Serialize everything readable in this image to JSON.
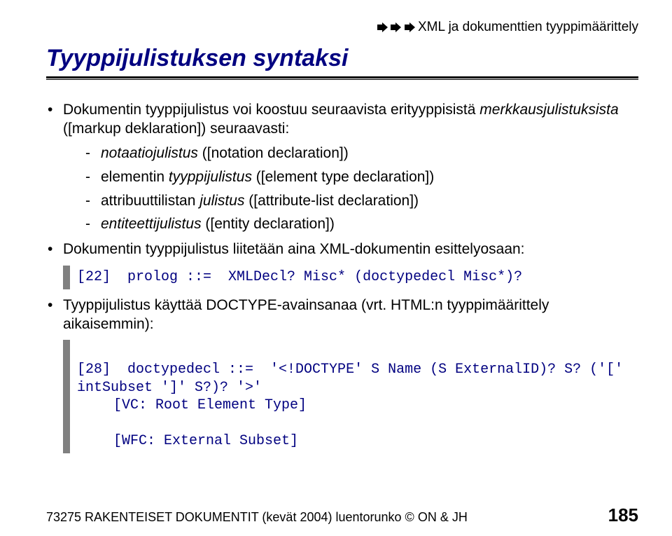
{
  "breadcrumb": "XML ja dokumenttien tyyppimäärittely",
  "title": "Tyyppijulistuksen syntaksi",
  "b1_pre": "Dokumentin tyyppijulistus voi koostuu seuraavista erityyppisistä ",
  "b1_it": "merkkausjulistuksista",
  "b1_post": " ([markup deklaration]) seuraavasti:",
  "d1_it": "notaatiojulistus",
  "d1_rest": " ([notation declaration])",
  "d2_pre": "elementin ",
  "d2_it": "tyyppijulistus",
  "d2_rest": " ([element type declaration])",
  "d3_pre": "attribuuttilistan ",
  "d3_it": "julistus",
  "d3_rest": " ([attribute-list declaration])",
  "d4_it": "entiteettijulistus",
  "d4_rest": " ([entity declaration])",
  "b2": "Dokumentin tyyppijulistus liitetään aina XML-dokumentin esittelyosaan:",
  "code1": "[22]  prolog ::=  XMLDecl? Misc* (doctypedecl Misc*)?",
  "b3": "Tyyppijulistus käyttää DOCTYPE-avainsanaa (vrt. HTML:n tyyppimäärittely aikaisemmin):",
  "code2a": "[28]  doctypedecl ::=  '<!DOCTYPE' S Name (S ExternalID)? S? ('[' intSubset ']' S?)? '>'",
  "code2b": "[VC: Root Element Type]",
  "code2c": "[WFC: External Subset]",
  "footer_text": "73275 RAKENTEISET DOKUMENTIT (kevät 2004) luentorunko © ON & JH",
  "page_number": "185"
}
